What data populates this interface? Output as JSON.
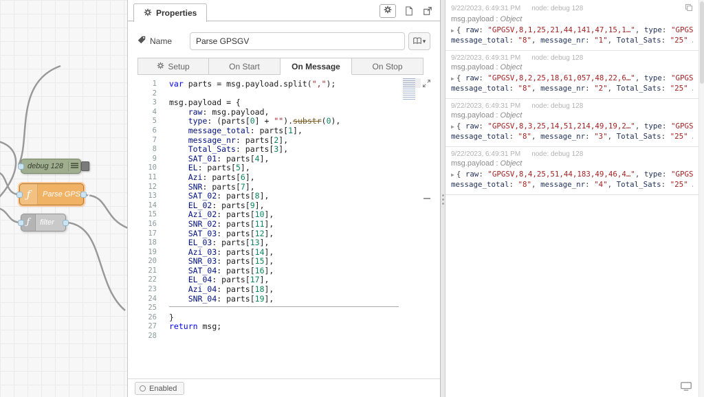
{
  "colors": {
    "function_node": "#f0b264",
    "function_node_selected_halo": "#ffc48f",
    "debug_node": "#9fae8f",
    "filter_node": "#c9c9c9",
    "wire": "#999999",
    "code_keyword": "#0000ff",
    "code_property": "#001080",
    "code_string": "#a31515",
    "code_number": "#098658",
    "debug_key": "#22325c",
    "debug_string": "#a62121"
  },
  "workspace": {
    "nodes": [
      {
        "label": "debug 128"
      },
      {
        "label": "Parse GPSGV"
      },
      {
        "label": "filter"
      }
    ]
  },
  "tray": {
    "header": {
      "title": "Properties",
      "buttons": [
        "gear",
        "document",
        "open-window"
      ]
    },
    "name": {
      "label": "Name",
      "value": "Parse GPSGV"
    },
    "tabs": [
      {
        "label": "Setup",
        "icon": "gear",
        "active": false
      },
      {
        "label": "On Start",
        "active": false
      },
      {
        "label": "On Message",
        "active": true
      },
      {
        "label": "On Stop",
        "active": false
      }
    ],
    "footer": {
      "enabled_label": "Enabled"
    },
    "code_lines": [
      [
        [
          "kw",
          "var"
        ],
        [
          "pl",
          " parts = msg.payload.split("
        ],
        [
          "str",
          "\",\""
        ],
        [
          "pl",
          ");"
        ]
      ],
      [],
      [
        [
          "pl",
          "msg.payload = {"
        ]
      ],
      [
        [
          "pl",
          "    "
        ],
        [
          "prop",
          "raw"
        ],
        [
          "pl",
          ": msg.payload,"
        ]
      ],
      [
        [
          "pl",
          "    "
        ],
        [
          "prop",
          "type"
        ],
        [
          "pl",
          ": (parts["
        ],
        [
          "num",
          "0"
        ],
        [
          "pl",
          "] + "
        ],
        [
          "str",
          "\"\""
        ],
        [
          "pl",
          ")."
        ],
        [
          "strike",
          "substr"
        ],
        [
          "pl",
          "("
        ],
        [
          "num",
          "0"
        ],
        [
          "pl",
          "),"
        ]
      ],
      [
        [
          "pl",
          "    "
        ],
        [
          "prop",
          "message_total"
        ],
        [
          "pl",
          ": parts["
        ],
        [
          "num",
          "1"
        ],
        [
          "pl",
          "],"
        ]
      ],
      [
        [
          "pl",
          "    "
        ],
        [
          "prop",
          "message_nr"
        ],
        [
          "pl",
          ": parts["
        ],
        [
          "num",
          "2"
        ],
        [
          "pl",
          "],"
        ]
      ],
      [
        [
          "pl",
          "    "
        ],
        [
          "prop",
          "Total_Sats"
        ],
        [
          "pl",
          ": parts["
        ],
        [
          "num",
          "3"
        ],
        [
          "pl",
          "],"
        ]
      ],
      [
        [
          "pl",
          "    "
        ],
        [
          "prop",
          "SAT_01"
        ],
        [
          "pl",
          ": parts["
        ],
        [
          "num",
          "4"
        ],
        [
          "pl",
          "],"
        ]
      ],
      [
        [
          "pl",
          "    "
        ],
        [
          "prop",
          "EL"
        ],
        [
          "pl",
          ": parts["
        ],
        [
          "num",
          "5"
        ],
        [
          "pl",
          "],"
        ]
      ],
      [
        [
          "pl",
          "    "
        ],
        [
          "prop",
          "Azi"
        ],
        [
          "pl",
          ": parts["
        ],
        [
          "num",
          "6"
        ],
        [
          "pl",
          "],"
        ]
      ],
      [
        [
          "pl",
          "    "
        ],
        [
          "prop",
          "SNR"
        ],
        [
          "pl",
          ": parts["
        ],
        [
          "num",
          "7"
        ],
        [
          "pl",
          "],"
        ]
      ],
      [
        [
          "pl",
          "    "
        ],
        [
          "prop",
          "SAT_02"
        ],
        [
          "pl",
          ": parts["
        ],
        [
          "num",
          "8"
        ],
        [
          "pl",
          "],"
        ]
      ],
      [
        [
          "pl",
          "    "
        ],
        [
          "prop",
          "EL_02"
        ],
        [
          "pl",
          ": parts["
        ],
        [
          "num",
          "9"
        ],
        [
          "pl",
          "],"
        ]
      ],
      [
        [
          "pl",
          "    "
        ],
        [
          "prop",
          "Azi_02"
        ],
        [
          "pl",
          ": parts["
        ],
        [
          "num",
          "10"
        ],
        [
          "pl",
          "],"
        ]
      ],
      [
        [
          "pl",
          "    "
        ],
        [
          "prop",
          "SNR_02"
        ],
        [
          "pl",
          ": parts["
        ],
        [
          "num",
          "11"
        ],
        [
          "pl",
          "],"
        ]
      ],
      [
        [
          "pl",
          "    "
        ],
        [
          "prop",
          "SAT_03"
        ],
        [
          "pl",
          ": parts["
        ],
        [
          "num",
          "12"
        ],
        [
          "pl",
          "],"
        ]
      ],
      [
        [
          "pl",
          "    "
        ],
        [
          "prop",
          "EL_03"
        ],
        [
          "pl",
          ": parts["
        ],
        [
          "num",
          "13"
        ],
        [
          "pl",
          "],"
        ]
      ],
      [
        [
          "pl",
          "    "
        ],
        [
          "prop",
          "Azi_03"
        ],
        [
          "pl",
          ": parts["
        ],
        [
          "num",
          "14"
        ],
        [
          "pl",
          "],"
        ]
      ],
      [
        [
          "pl",
          "    "
        ],
        [
          "prop",
          "SNR_03"
        ],
        [
          "pl",
          ": parts["
        ],
        [
          "num",
          "15"
        ],
        [
          "pl",
          "],"
        ]
      ],
      [
        [
          "pl",
          "    "
        ],
        [
          "prop",
          "SAT_04"
        ],
        [
          "pl",
          ": parts["
        ],
        [
          "num",
          "16"
        ],
        [
          "pl",
          "],"
        ]
      ],
      [
        [
          "pl",
          "    "
        ],
        [
          "prop",
          "EL_04"
        ],
        [
          "pl",
          ": parts["
        ],
        [
          "num",
          "17"
        ],
        [
          "pl",
          "],"
        ]
      ],
      [
        [
          "pl",
          "    "
        ],
        [
          "prop",
          "Azi_04"
        ],
        [
          "pl",
          ": parts["
        ],
        [
          "num",
          "18"
        ],
        [
          "pl",
          "],"
        ]
      ],
      [
        [
          "pl",
          "    "
        ],
        [
          "prop",
          "SNR_04"
        ],
        [
          "pl",
          ": parts["
        ],
        [
          "num",
          "19"
        ],
        [
          "pl",
          "],"
        ]
      ],
      [],
      [
        [
          "pl",
          "}"
        ]
      ],
      [
        [
          "kw",
          "return"
        ],
        [
          "pl",
          " msg;"
        ]
      ],
      []
    ]
  },
  "sidebar": {
    "entries": [
      {
        "timestamp": "9/22/2023, 6:49:31 PM",
        "node": "node: debug 128",
        "path": "msg.payload",
        "type": "Object",
        "preview_lines": [
          [
            [
              "p",
              "{ "
            ],
            [
              "k",
              "raw"
            ],
            [
              "p",
              ": "
            ],
            [
              "s",
              "\"GPGSV,8,1,25,21,44,141,47,15,1…\""
            ],
            [
              "p",
              ", "
            ],
            [
              "k",
              "type"
            ],
            [
              "p",
              ": "
            ],
            [
              "s",
              "\"GPGSV\""
            ],
            [
              "p",
              ","
            ]
          ],
          [
            [
              "k",
              "message_total"
            ],
            [
              "p",
              ": "
            ],
            [
              "s",
              "\"8\""
            ],
            [
              "p",
              ", "
            ],
            [
              "k",
              "message_nr"
            ],
            [
              "p",
              ": "
            ],
            [
              "s",
              "\"1\""
            ],
            [
              "p",
              ", "
            ],
            [
              "k",
              "Total_Sats"
            ],
            [
              "p",
              ": "
            ],
            [
              "s",
              "\"25\""
            ],
            [
              "p",
              " … }"
            ]
          ]
        ]
      },
      {
        "timestamp": "9/22/2023, 6:49:31 PM",
        "node": "node: debug 128",
        "path": "msg.payload",
        "type": "Object",
        "preview_lines": [
          [
            [
              "p",
              "{ "
            ],
            [
              "k",
              "raw"
            ],
            [
              "p",
              ": "
            ],
            [
              "s",
              "\"GPGSV,8,2,25,18,61,057,48,22,6…\""
            ],
            [
              "p",
              ", "
            ],
            [
              "k",
              "type"
            ],
            [
              "p",
              ": "
            ],
            [
              "s",
              "\"GPGSV\""
            ],
            [
              "p",
              ","
            ]
          ],
          [
            [
              "k",
              "message_total"
            ],
            [
              "p",
              ": "
            ],
            [
              "s",
              "\"8\""
            ],
            [
              "p",
              ", "
            ],
            [
              "k",
              "message_nr"
            ],
            [
              "p",
              ": "
            ],
            [
              "s",
              "\"2\""
            ],
            [
              "p",
              ", "
            ],
            [
              "k",
              "Total_Sats"
            ],
            [
              "p",
              ": "
            ],
            [
              "s",
              "\"25\""
            ],
            [
              "p",
              " … }"
            ]
          ]
        ]
      },
      {
        "timestamp": "9/22/2023, 6:49:31 PM",
        "node": "node: debug 128",
        "path": "msg.payload",
        "type": "Object",
        "preview_lines": [
          [
            [
              "p",
              "{ "
            ],
            [
              "k",
              "raw"
            ],
            [
              "p",
              ": "
            ],
            [
              "s",
              "\"GPGSV,8,3,25,14,51,214,49,19,2…\""
            ],
            [
              "p",
              ", "
            ],
            [
              "k",
              "type"
            ],
            [
              "p",
              ": "
            ],
            [
              "s",
              "\"GPGSV\""
            ],
            [
              "p",
              ","
            ]
          ],
          [
            [
              "k",
              "message_total"
            ],
            [
              "p",
              ": "
            ],
            [
              "s",
              "\"8\""
            ],
            [
              "p",
              ", "
            ],
            [
              "k",
              "message_nr"
            ],
            [
              "p",
              ": "
            ],
            [
              "s",
              "\"3\""
            ],
            [
              "p",
              ", "
            ],
            [
              "k",
              "Total_Sats"
            ],
            [
              "p",
              ": "
            ],
            [
              "s",
              "\"25\""
            ],
            [
              "p",
              " … }"
            ]
          ]
        ]
      },
      {
        "timestamp": "9/22/2023, 6:49:31 PM",
        "node": "node: debug 128",
        "path": "msg.payload",
        "type": "Object",
        "preview_lines": [
          [
            [
              "p",
              "{ "
            ],
            [
              "k",
              "raw"
            ],
            [
              "p",
              ": "
            ],
            [
              "s",
              "\"GPGSV,8,4,25,51,44,183,49,46,4…\""
            ],
            [
              "p",
              ", "
            ],
            [
              "k",
              "type"
            ],
            [
              "p",
              ": "
            ],
            [
              "s",
              "\"GPGSV\""
            ],
            [
              "p",
              ","
            ]
          ],
          [
            [
              "k",
              "message_total"
            ],
            [
              "p",
              ": "
            ],
            [
              "s",
              "\"8\""
            ],
            [
              "p",
              ", "
            ],
            [
              "k",
              "message_nr"
            ],
            [
              "p",
              ": "
            ],
            [
              "s",
              "\"4\""
            ],
            [
              "p",
              ", "
            ],
            [
              "k",
              "Total_Sats"
            ],
            [
              "p",
              ": "
            ],
            [
              "s",
              "\"25\""
            ],
            [
              "p",
              " … }"
            ]
          ]
        ]
      }
    ]
  }
}
